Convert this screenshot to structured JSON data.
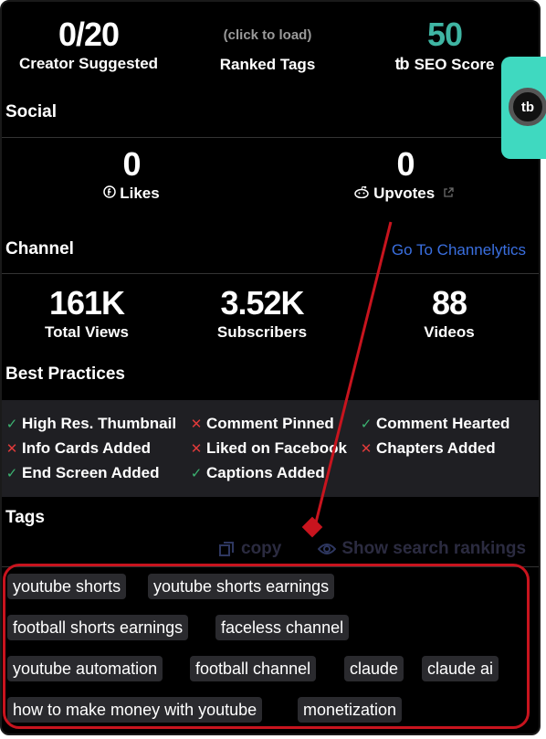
{
  "top_stats": {
    "creator": {
      "value": "0/20",
      "label": "Creator Suggested"
    },
    "ranked": {
      "hint": "(click to load)",
      "label": "Ranked Tags"
    },
    "seo": {
      "value": "50",
      "label": "SEO Score",
      "icon": "tb-logo-icon",
      "color": "#3fb5a3"
    }
  },
  "social": {
    "title": "Social",
    "likes": {
      "value": "0",
      "label": "Likes",
      "icon": "facebook-icon"
    },
    "upvotes": {
      "value": "0",
      "label": "Upvotes",
      "icon": "reddit-icon",
      "extra_icon": "external-link-icon"
    }
  },
  "channel": {
    "title": "Channel",
    "link": "Go To Channelytics",
    "stats": [
      {
        "value": "161K",
        "label": "Total Views"
      },
      {
        "value": "3.52K",
        "label": "Subscribers"
      },
      {
        "value": "88",
        "label": "Videos"
      }
    ]
  },
  "best_practices": {
    "title": "Best Practices",
    "items": [
      {
        "label": "High Res. Thumbnail",
        "status": "pass"
      },
      {
        "label": "Comment Pinned",
        "status": "fail"
      },
      {
        "label": "Comment Hearted",
        "status": "pass"
      },
      {
        "label": "Info Cards Added",
        "status": "fail"
      },
      {
        "label": "Liked on Facebook",
        "status": "fail"
      },
      {
        "label": "Chapters Added",
        "status": "fail"
      },
      {
        "label": "End Screen Added",
        "status": "pass"
      },
      {
        "label": "Captions Added",
        "status": "pass"
      }
    ]
  },
  "tags": {
    "title": "Tags",
    "copy_label": "copy",
    "rankings_label": "Show search rankings",
    "items": [
      "youtube shorts",
      "youtube shorts earnings",
      "football shorts earnings",
      "faceless channel",
      "youtube automation",
      "football channel",
      "claude",
      "claude ai",
      "how to make money with youtube",
      "monetization"
    ]
  },
  "colors": {
    "accent": "#3fd9c0",
    "annotation": "#c8141e",
    "link": "#3a6fe0",
    "pass": "#3cb371",
    "fail": "#e03a3a"
  }
}
